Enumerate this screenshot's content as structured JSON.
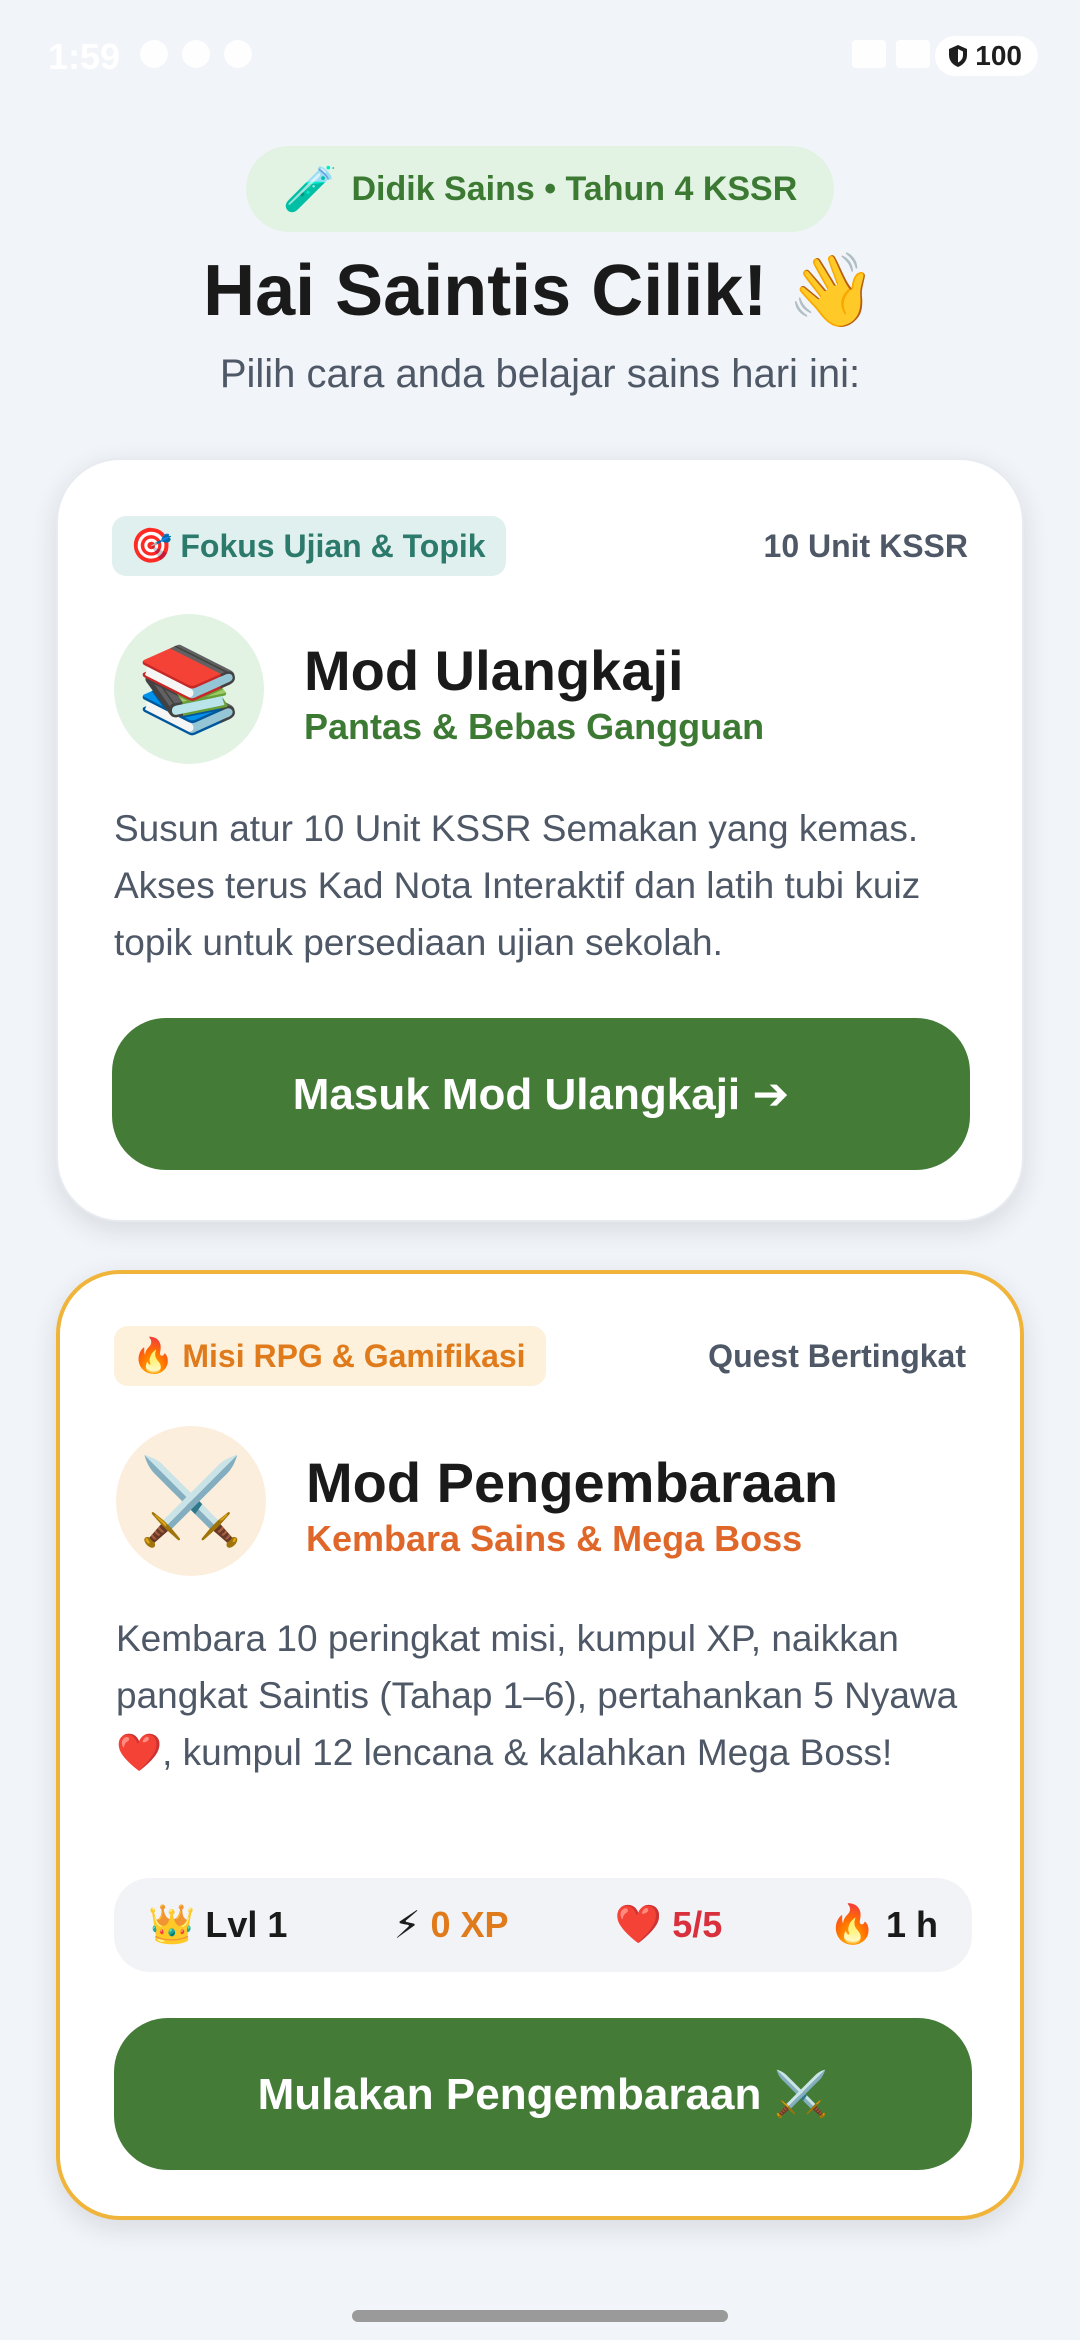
{
  "status_bar": {
    "time": "1:59",
    "battery": "100"
  },
  "header": {
    "pill_emoji": "🧪",
    "pill_label": "Didik Sains • Tahun 4 KSSR",
    "greeting": "Hai Saintis Cilik! 👋",
    "subtitle": "Pilih cara anda belajar sains hari ini:"
  },
  "cards": [
    {
      "badge_emoji": "🎯",
      "badge_label": "Fokus Ujian & Topik",
      "meta": "10 Unit KSSR",
      "icon_emoji": "📚",
      "title": "Mod Ulangkaji",
      "subtitle": "Pantas & Bebas Gangguan",
      "description": "Susun atur 10 Unit KSSR Semakan yang kemas. Akses terus Kad Nota Interaktif dan latih tubi kuiz topik untuk persediaan ujian sekolah.",
      "button_label": "Masuk Mod Ulangkaji ➔"
    },
    {
      "badge_emoji": "🔥",
      "badge_label": "Misi RPG & Gamifikasi",
      "meta": "Quest Bertingkat",
      "icon_emoji": "⚔️",
      "title": "Mod Pengembaraan",
      "subtitle": "Kembara Sains & Mega Boss",
      "description": "Kembara 10 peringkat misi, kumpul XP, naikkan pangkat Saintis (Tahap 1–6), pertahankan 5 Nyawa ❤️, kumpul 12 lencana & kalahkan Mega Boss!",
      "button_label": "Mulakan Pengembaraan ⚔️",
      "stats": [
        {
          "emoji": "👑",
          "label": "Lvl 1",
          "color": "#1a1a1a"
        },
        {
          "emoji": "⚡",
          "label": "0 XP",
          "color": "#e07b1c"
        },
        {
          "emoji": "❤️",
          "label": "5/5",
          "color": "#d8303c"
        },
        {
          "emoji": "🔥",
          "label": "1 h",
          "color": "#1a1a1a"
        }
      ]
    }
  ],
  "colors": {
    "brand_green": "#447c37",
    "accent_orange": "#f0b43a",
    "background": "#f1f4f8"
  }
}
